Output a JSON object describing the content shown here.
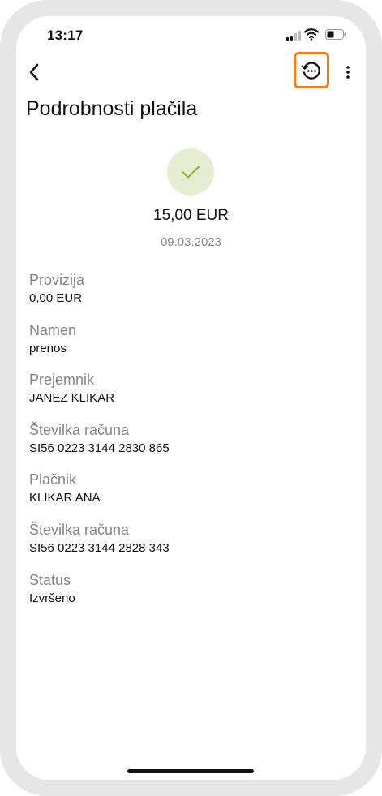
{
  "status_bar": {
    "time": "13:17"
  },
  "header": {
    "title": "Podrobnosti plačila",
    "back_icon": "chevron-left-icon",
    "history_icon": "history-icon",
    "more_icon": "more-vertical-icon",
    "highlight_color": "#f07d1d"
  },
  "summary": {
    "status_icon": "checkmark-icon",
    "amount": "15,00 EUR",
    "date": "09.03.2023",
    "success_bg": "#e5eed1",
    "success_color": "#8ab63c"
  },
  "details": [
    {
      "label": "Provizija",
      "value": "0,00 EUR"
    },
    {
      "label": "Namen",
      "value": "prenos"
    },
    {
      "label": "Prejemnik",
      "value": "JANEZ KLIKAR"
    },
    {
      "label": "Številka računa",
      "value": "SI56 0223 3144 2830 865"
    },
    {
      "label": "Plačnik",
      "value": "KLIKAR ANA"
    },
    {
      "label": "Številka računa",
      "value": "SI56 0223 3144 2828 343"
    },
    {
      "label": "Status",
      "value": "Izvršeno"
    }
  ]
}
